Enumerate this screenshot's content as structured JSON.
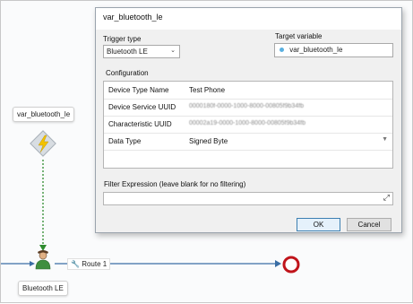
{
  "canvas": {
    "variable_node_label": "var_bluetooth_le",
    "actor_label": "Bluetooth LE",
    "route_label": "Route 1"
  },
  "dialog": {
    "title": "var_bluetooth_le",
    "trigger_type_label": "Trigger type",
    "trigger_type_value": "Bluetooth LE",
    "target_variable_label": "Target variable",
    "target_variable_value": "var_bluetooth_le",
    "configuration_label": "Configuration",
    "config_rows": [
      {
        "key": "Device Type Name",
        "value": "Test Phone",
        "blurred": false
      },
      {
        "key": "Device Service UUID",
        "value": "0000180f-0000-1000-8000-00805f9b34fb",
        "blurred": true
      },
      {
        "key": "Characteristic UUID",
        "value": "00002a19-0000-1000-8000-00805f9b34fb",
        "blurred": true
      },
      {
        "key": "Data Type",
        "value": "Signed Byte",
        "blurred": false
      }
    ],
    "filter_label": "Filter Expression (leave blank for no filtering)",
    "filter_value": "",
    "ok_label": "OK",
    "cancel_label": "Cancel"
  },
  "colors": {
    "accent": "#3c7fb1",
    "flow_line": "#3a6ea5",
    "trigger_dotted": "#2e8b2e",
    "end_node": "#c0141b",
    "trigger_icon_bg": "#d8dde2",
    "trigger_bolt": "#f2c200"
  },
  "icons": {
    "trigger": "lightning-bolt-icon",
    "actor": "person-icon",
    "route": "wrench-icon",
    "end": "end-circle-icon",
    "expand": "expand-arrows-icon",
    "dropdown": "chevron-down-icon",
    "variable": "variable-dot-icon"
  }
}
